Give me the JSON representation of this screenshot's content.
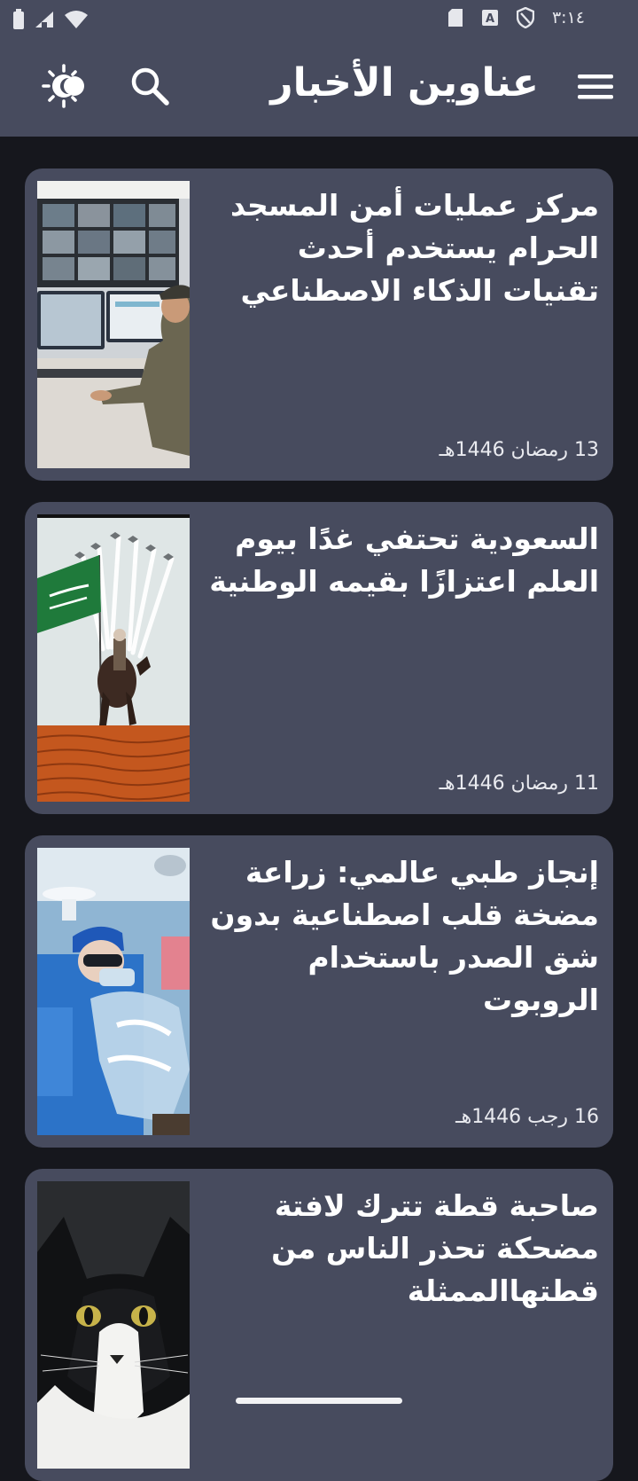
{
  "status_bar": {
    "time": "٣:١٤",
    "icons": [
      "battery-icon",
      "signal-icon",
      "wifi-icon",
      "sd-card-icon",
      "a-notification-icon",
      "shield-vpn-icon"
    ]
  },
  "app_bar": {
    "title": "عناوين الأخبار",
    "icons": [
      "menu-icon",
      "search-icon",
      "theme-toggle-icon"
    ]
  },
  "articles": [
    {
      "title": "مركز عمليات أمن المسجد الحرام يستخدم أحدث تقنيات الذكاء الاصطناعي",
      "date": "13 رمضان 1446هـ",
      "image": "operations-center-photo"
    },
    {
      "title": "السعودية تحتفي غدًا بيوم العلم اعتزازًا بقيمه الوطنية",
      "date": "11 رمضان 1446هـ",
      "image": "saudi-flag-day-photo"
    },
    {
      "title": "إنجاز طبي عالمي: زراعة مضخة قلب اصطناعية بدون شق الصدر باستخدام الروبوت",
      "date": "16 رجب 1446هـ",
      "image": "robotic-surgery-photo"
    },
    {
      "title": "صاحبة قطة تترك لافتة مضحكة تحذر الناس من قطتهاالممثلة",
      "date": "",
      "image": "cat-photo"
    }
  ],
  "colors": {
    "background": "#16171d",
    "surface": "#474b5e",
    "text": "#ffffff"
  }
}
